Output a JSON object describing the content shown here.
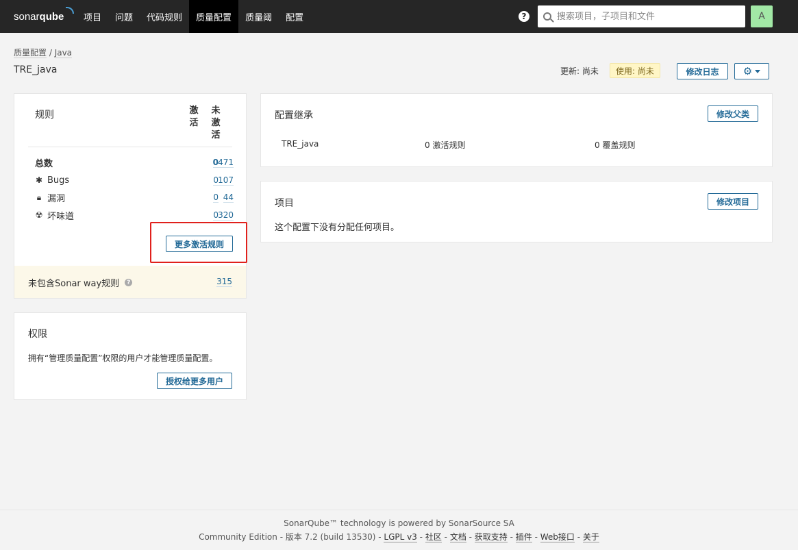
{
  "nav": {
    "logo_a": "sonar",
    "logo_b": "qube",
    "items": [
      "项目",
      "问题",
      "代码规则",
      "质量配置",
      "质量阈",
      "配置"
    ],
    "active_index": 3,
    "help_icon": "?",
    "search_placeholder": "搜索项目，子项目和文件",
    "avatar_letter": "A"
  },
  "header": {
    "breadcrumb_root": "质量配置",
    "breadcrumb_sep": " / ",
    "breadcrumb_lang": "Java",
    "title": "TRE_java",
    "updated": "更新: 尚未",
    "used": "使用: 尚未",
    "changelog_button": "修改日志"
  },
  "rules": {
    "title": "规则",
    "col_active": "激活",
    "col_inactive": "未激活",
    "rows": [
      {
        "label": "总数",
        "icon": "",
        "active": "0",
        "inactive": "471"
      },
      {
        "label": "Bugs",
        "icon": "bug-icon",
        "active": "0",
        "inactive": "107"
      },
      {
        "label": "漏洞",
        "icon": "lock-icon",
        "active": "0",
        "inactive": "44"
      },
      {
        "label": "坏味道",
        "icon": "code-smell-icon",
        "active": "0",
        "inactive": "320"
      }
    ],
    "more_button": "更多激活规则",
    "sonar_way_label": "未包含Sonar way规则",
    "sonar_way_count": "315"
  },
  "permissions": {
    "title": "权限",
    "description": "拥有“管理质量配置”权限的用户才能管理质量配置。",
    "grant_button": "授权给更多用户"
  },
  "inheritance": {
    "title": "配置继承",
    "change_parent_button": "修改父类",
    "profile_name": "TRE_java",
    "active_rules": "0 激活规则",
    "overridden_rules": "0 覆盖规则"
  },
  "projects": {
    "title": "项目",
    "change_projects_button": "修改项目",
    "empty_text": "这个配置下没有分配任何项目。"
  },
  "footer": {
    "line1": "SonarQube™ technology is powered by SonarSource SA",
    "edition": "Community Edition",
    "version": "版本 7.2 (build 13530)",
    "license": "LGPL v3",
    "community": "社区",
    "docs": "文档",
    "support": "获取支持",
    "plugins": "插件",
    "web_api": "Web接口",
    "about": "关于"
  },
  "colors": {
    "accent": "#236a97",
    "nav_bg": "#262626",
    "highlight": "#e0201c"
  }
}
